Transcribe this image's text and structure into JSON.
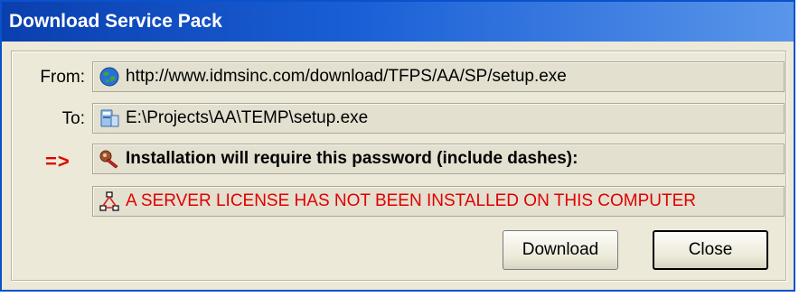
{
  "window": {
    "title": "Download Service Pack"
  },
  "fields": {
    "from_label": "From:",
    "from_value": "http://www.idmsinc.com/download/TFPS/AA/SP/setup.exe",
    "from_icon": "globe-icon",
    "to_label": "To:",
    "to_value": "E:\\Projects\\AA\\TEMP\\setup.exe",
    "to_icon": "computer-icon",
    "password_marker": "=>",
    "password_value": "Installation will require this password (include dashes):",
    "password_icon": "key-icon",
    "license_value": "A SERVER LICENSE HAS NOT BEEN INSTALLED ON THIS COMPUTER",
    "license_icon": "network-icon"
  },
  "buttons": {
    "download_label": "Download",
    "close_label": "Close"
  },
  "colors": {
    "title_bar": "#0a52cc",
    "warning_text": "#e00000",
    "dialog_bg": "#ece9d8"
  }
}
